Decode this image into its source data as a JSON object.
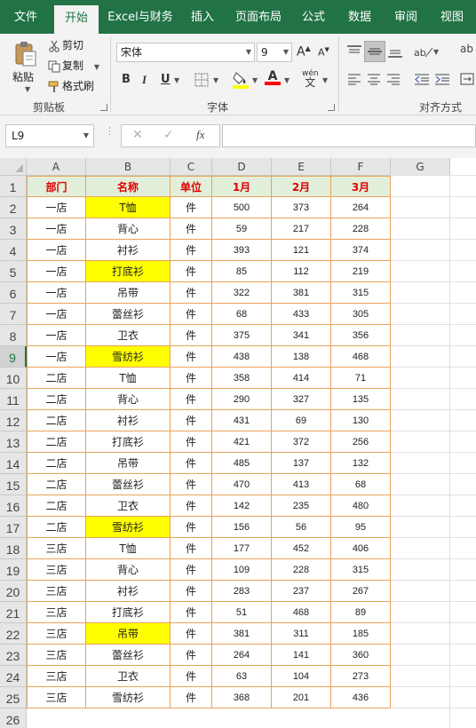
{
  "tabs": [
    {
      "label": "文件",
      "active": false
    },
    {
      "label": "开始",
      "active": true
    },
    {
      "label": "Excel与财务",
      "active": false
    },
    {
      "label": "插入",
      "active": false
    },
    {
      "label": "页面布局",
      "active": false
    },
    {
      "label": "公式",
      "active": false
    },
    {
      "label": "数据",
      "active": false
    },
    {
      "label": "审阅",
      "active": false
    },
    {
      "label": "视图",
      "active": false
    }
  ],
  "clipboard": {
    "paste_label": "粘贴",
    "cut_label": "剪切",
    "copy_label": "复制",
    "format_painter_label": "格式刷",
    "group_label": "剪贴板"
  },
  "font": {
    "font_name": "宋体",
    "font_size": "9",
    "bold": "B",
    "italic": "I",
    "underline": "U",
    "group_label": "字体",
    "grow_glyph": "A",
    "shrink_glyph": "A",
    "font_color_glyph": "A",
    "phonetic_glyph": "wén",
    "font_color": "#ff0000",
    "fill_color": "#ffff00"
  },
  "alignment": {
    "group_label": "对齐方式"
  },
  "formula_bar": {
    "name_box": "L9",
    "fx_label": "fx",
    "formula": ""
  },
  "accent_color": "#217346",
  "columns": [
    "A",
    "B",
    "C",
    "D",
    "E",
    "F",
    "G"
  ],
  "header_row": [
    "部门",
    "名称",
    "单位",
    "1月",
    "2月",
    "3月"
  ],
  "rows": [
    {
      "dept": "一店",
      "name": "T恤",
      "unit": "件",
      "m1": 500,
      "m2": 373,
      "m3": 264,
      "highlight": true
    },
    {
      "dept": "一店",
      "name": "背心",
      "unit": "件",
      "m1": 59,
      "m2": 217,
      "m3": 228,
      "highlight": false
    },
    {
      "dept": "一店",
      "name": "衬衫",
      "unit": "件",
      "m1": 393,
      "m2": 121,
      "m3": 374,
      "highlight": false
    },
    {
      "dept": "一店",
      "name": "打底衫",
      "unit": "件",
      "m1": 85,
      "m2": 112,
      "m3": 219,
      "highlight": true
    },
    {
      "dept": "一店",
      "name": "吊带",
      "unit": "件",
      "m1": 322,
      "m2": 381,
      "m3": 315,
      "highlight": false
    },
    {
      "dept": "一店",
      "name": "蕾丝衫",
      "unit": "件",
      "m1": 68,
      "m2": 433,
      "m3": 305,
      "highlight": false
    },
    {
      "dept": "一店",
      "name": "卫衣",
      "unit": "件",
      "m1": 375,
      "m2": 341,
      "m3": 356,
      "highlight": false
    },
    {
      "dept": "一店",
      "name": "雪纺衫",
      "unit": "件",
      "m1": 438,
      "m2": 138,
      "m3": 468,
      "highlight": true
    },
    {
      "dept": "二店",
      "name": "T恤",
      "unit": "件",
      "m1": 358,
      "m2": 414,
      "m3": 71,
      "highlight": false
    },
    {
      "dept": "二店",
      "name": "背心",
      "unit": "件",
      "m1": 290,
      "m2": 327,
      "m3": 135,
      "highlight": false
    },
    {
      "dept": "二店",
      "name": "衬衫",
      "unit": "件",
      "m1": 431,
      "m2": 69,
      "m3": 130,
      "highlight": false
    },
    {
      "dept": "二店",
      "name": "打底衫",
      "unit": "件",
      "m1": 421,
      "m2": 372,
      "m3": 256,
      "highlight": false
    },
    {
      "dept": "二店",
      "name": "吊带",
      "unit": "件",
      "m1": 485,
      "m2": 137,
      "m3": 132,
      "highlight": false
    },
    {
      "dept": "二店",
      "name": "蕾丝衫",
      "unit": "件",
      "m1": 470,
      "m2": 413,
      "m3": 68,
      "highlight": false
    },
    {
      "dept": "二店",
      "name": "卫衣",
      "unit": "件",
      "m1": 142,
      "m2": 235,
      "m3": 480,
      "highlight": false
    },
    {
      "dept": "二店",
      "name": "雪纺衫",
      "unit": "件",
      "m1": 156,
      "m2": 56,
      "m3": 95,
      "highlight": true
    },
    {
      "dept": "三店",
      "name": "T恤",
      "unit": "件",
      "m1": 177,
      "m2": 452,
      "m3": 406,
      "highlight": false
    },
    {
      "dept": "三店",
      "name": "背心",
      "unit": "件",
      "m1": 109,
      "m2": 228,
      "m3": 315,
      "highlight": false
    },
    {
      "dept": "三店",
      "name": "衬衫",
      "unit": "件",
      "m1": 283,
      "m2": 237,
      "m3": 267,
      "highlight": false
    },
    {
      "dept": "三店",
      "name": "打底衫",
      "unit": "件",
      "m1": 51,
      "m2": 468,
      "m3": 89,
      "highlight": false
    },
    {
      "dept": "三店",
      "name": "吊带",
      "unit": "件",
      "m1": 381,
      "m2": 311,
      "m3": 185,
      "highlight": true
    },
    {
      "dept": "三店",
      "name": "蕾丝衫",
      "unit": "件",
      "m1": 264,
      "m2": 141,
      "m3": 360,
      "highlight": false
    },
    {
      "dept": "三店",
      "name": "卫衣",
      "unit": "件",
      "m1": 63,
      "m2": 104,
      "m3": 273,
      "highlight": false
    },
    {
      "dept": "三店",
      "name": "雪纺衫",
      "unit": "件",
      "m1": 368,
      "m2": 201,
      "m3": 436,
      "highlight": false
    }
  ],
  "row_numbers": [
    1,
    2,
    3,
    4,
    5,
    6,
    7,
    8,
    9,
    10,
    11,
    12,
    13,
    14,
    15,
    16,
    17,
    18,
    19,
    20,
    21,
    22,
    23,
    24,
    25,
    26
  ],
  "selected_row": 9
}
